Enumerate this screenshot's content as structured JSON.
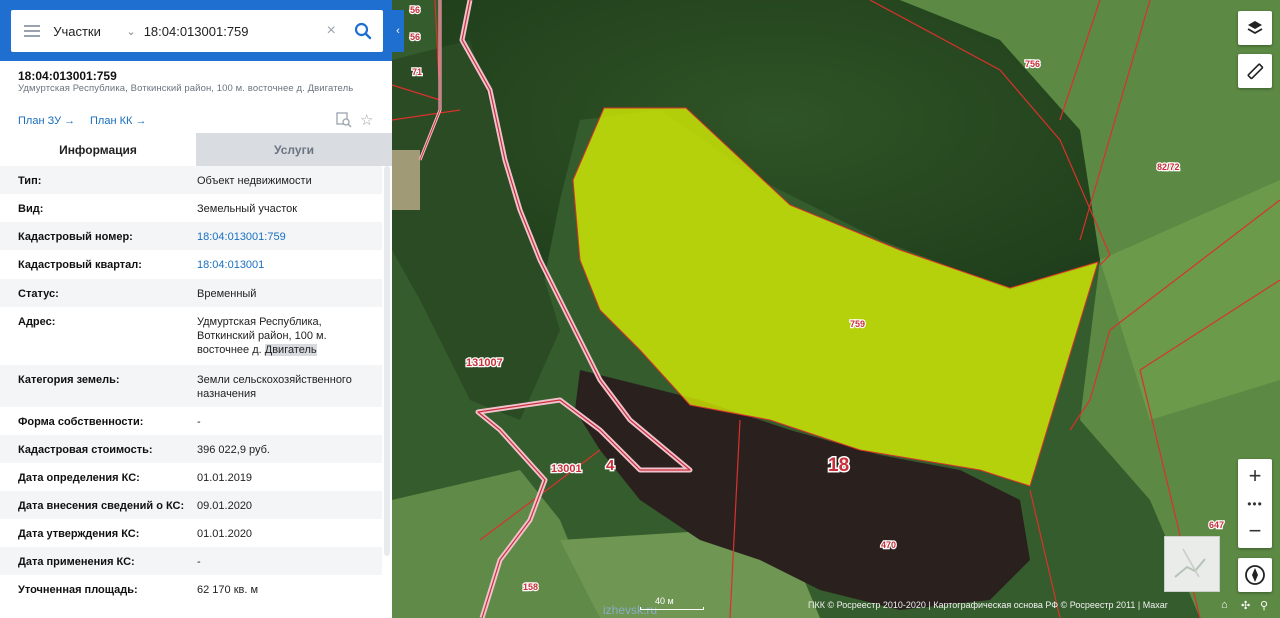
{
  "search": {
    "type_label": "Участки",
    "query": "18:04:013001:759"
  },
  "parcel": {
    "title": "18:04:013001:759",
    "address_short": "Удмуртская Республика, Воткинский район, 100 м. восточнее д. Двигатель",
    "plan_zu": "План ЗУ →",
    "plan_kk": "План КК →"
  },
  "tabs": [
    {
      "label": "Информация",
      "active": true
    },
    {
      "label": "Услуги",
      "active": false
    }
  ],
  "info": [
    {
      "key": "Тип:",
      "value": "Объект недвижимости"
    },
    {
      "key": "Вид:",
      "value": "Земельный участок"
    },
    {
      "key": "Кадастровый номер:",
      "value": "18:04:013001:759",
      "link": true
    },
    {
      "key": "Кадастровый квартал:",
      "value": "18:04:013001",
      "link": true
    },
    {
      "key": "Статус:",
      "value": "Временный"
    },
    {
      "key": "Адрес:",
      "value_parts": [
        "Удмуртская Республика, Воткинский район, 100 м. восточнее д. ",
        "Двигатель"
      ]
    },
    {
      "key": "Категория земель:",
      "value": "Земли сельскохозяйственного назначения"
    },
    {
      "key": "Форма собственности:",
      "value": "-"
    },
    {
      "key": "Кадастровая стоимость:",
      "value": "396 022,9 руб."
    },
    {
      "key": "Дата определения КС:",
      "value": "01.01.2019"
    },
    {
      "key": "Дата внесения сведений о КС:",
      "value": "09.01.2020"
    },
    {
      "key": "Дата утверждения КС:",
      "value": "01.01.2020"
    },
    {
      "key": "Дата применения КС:",
      "value": "-"
    },
    {
      "key": "Уточненная площадь:",
      "value": "62 170 кв. м"
    }
  ],
  "map": {
    "labels": {
      "a56": "56",
      "a71": "71",
      "a756": "756",
      "a82772": "82/72",
      "a759": "759",
      "a131007": "131007",
      "a13001": "13001",
      "a4": "4",
      "a18": "18",
      "a470": "470",
      "a158": "158",
      "a647": "647"
    },
    "scale_label": "40 м",
    "attribution": "ПКК © Росреестр 2010-2020 | Картографическая основа РФ © Росреестр 2011 | Maxar",
    "watermark": "izhevsk.ru"
  },
  "icons": {
    "menu": "menu-icon",
    "search": "search-icon",
    "clear": "close-icon",
    "layers": "layers-icon",
    "ruler": "ruler-icon",
    "compass": "compass-icon",
    "star": "star-icon"
  },
  "colors": {
    "header_blue": "#1e6fcf",
    "link_blue": "#1a6fbe",
    "parcel_fill": "#e6ff00",
    "boundary": "#d9322c"
  }
}
